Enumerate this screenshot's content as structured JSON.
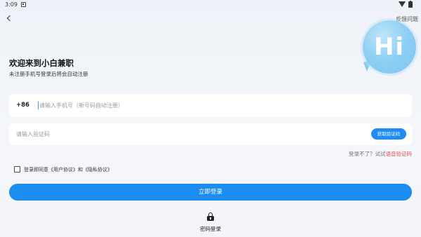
{
  "status_bar": {
    "time": "3:09",
    "icons": [
      "notification-icon",
      "wifi-icon",
      "battery-icon"
    ]
  },
  "header": {
    "back_icon": "chevron-left-icon",
    "feedback_label": "反馈问题"
  },
  "hero": {
    "bubble_text": "Hi",
    "bubble_color": "#8fd0f4"
  },
  "welcome": {
    "title": "欢迎来到小白兼职",
    "subtitle": "未注册手机号登录后将会自动注册"
  },
  "phone_field": {
    "country_code": "+86",
    "value": "",
    "placeholder": "请输入手机号（新号码自动注册）"
  },
  "code_field": {
    "value": "",
    "placeholder": "请输入验证码",
    "get_code_label": "获取验证码"
  },
  "login_help": {
    "question": "登录不了？试试",
    "voice_code_link": "语音验证码"
  },
  "agreement": {
    "checked": false,
    "text": "登录即同意《用户协议》和《隐私协议》"
  },
  "login_button": {
    "label": "立即登录"
  },
  "password_login": {
    "icon": "lock-icon",
    "label": "密码登录"
  },
  "colors": {
    "accent": "#1b8df0",
    "link_red": "#e0544e",
    "background": "#f3f5f9"
  }
}
